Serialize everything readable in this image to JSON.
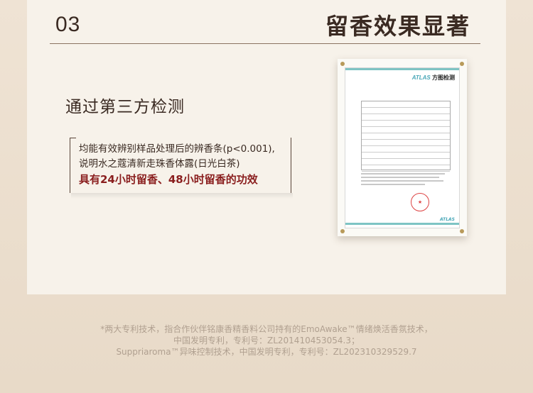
{
  "section": {
    "number": "03",
    "title": "留香效果显著"
  },
  "subheading": "通过第三方检测",
  "claim": {
    "line1": "均能有效辨别样品处理后的辨香条(p<0.001),",
    "line2": "说明水之蔻清新走珠香体露(日光白茶)",
    "highlight": "具有24小时留香、48小时留香的功效"
  },
  "certificate": {
    "brand_logo": "ATLAS",
    "brand_name": "方图检测",
    "footer_logo": "ATLAS",
    "seal_icon": "red-seal-icon"
  },
  "footnote": {
    "line1": "*两大专利技术，指合作伙伴铭康香精香料公司持有的EmoAwake™情绪焕活香氛技术，",
    "line2": "中国发明专利，专利号：ZL201410453054.3；",
    "line3": "Suppriaroma™异味控制技术，中国发明专利，专利号：ZL202310329529.7"
  },
  "colors": {
    "highlight": "#8a1e1e",
    "accent": "#4aa8b8"
  }
}
